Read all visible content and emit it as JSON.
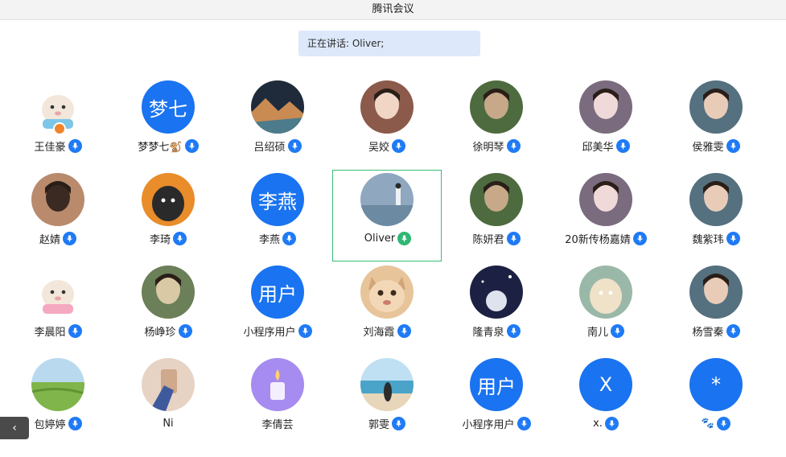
{
  "window": {
    "title": "腾讯会议"
  },
  "speaking": {
    "text": "正在讲话: Oliver;"
  },
  "participants": [
    {
      "name": "王佳豪",
      "avatar": "cartoon-animal",
      "badge": true
    },
    {
      "name": "梦梦七🐒",
      "avatar_text": "梦七",
      "avatar": "text"
    },
    {
      "name": "吕绍硕",
      "avatar": "landscape-photo"
    },
    {
      "name": "吴姣",
      "avatar": "portrait-photo"
    },
    {
      "name": "徐明琴",
      "avatar": "portrait-photo"
    },
    {
      "name": "邱美华",
      "avatar": "portrait-photo"
    },
    {
      "name": "侯雅雯",
      "avatar": "portrait-photo"
    },
    {
      "name": "赵婧",
      "avatar": "portrait-photo"
    },
    {
      "name": "李琦",
      "avatar": "cartoon-photo"
    },
    {
      "name": "李燕",
      "avatar_text": "李燕",
      "avatar": "text"
    },
    {
      "name": "Oliver",
      "avatar": "seaside-photo",
      "active": true
    },
    {
      "name": "陈妍君",
      "avatar": "portrait-photo"
    },
    {
      "name": "20新传杨嘉婧",
      "avatar": "portrait-photo"
    },
    {
      "name": "魏紫玮",
      "avatar": "portrait-photo"
    },
    {
      "name": "李晨阳",
      "avatar": "cartoon-animal"
    },
    {
      "name": "杨峥珍",
      "avatar": "portrait-photo"
    },
    {
      "name": "小程序用户",
      "avatar_text": "用户",
      "avatar": "text"
    },
    {
      "name": "刘海霞",
      "avatar": "cat-photo"
    },
    {
      "name": "隆青泉",
      "avatar": "night-photo"
    },
    {
      "name": "南儿",
      "avatar": "cartoon-photo"
    },
    {
      "name": "杨雪秦",
      "avatar": "portrait-photo"
    },
    {
      "name": "包婷婷",
      "avatar": "field-photo"
    },
    {
      "name": "Ni",
      "avatar": "hand-photo",
      "no_mic": true
    },
    {
      "name": "李倩芸",
      "avatar": "purple-illustration",
      "no_mic": true
    },
    {
      "name": "郭雯",
      "avatar": "beach-photo"
    },
    {
      "name": "小程序用户",
      "avatar_text": "用户",
      "avatar": "text"
    },
    {
      "name": "x.",
      "avatar_text": "X",
      "avatar": "text"
    },
    {
      "name": "🐾",
      "avatar_text": "*",
      "avatar": "text"
    }
  ]
}
